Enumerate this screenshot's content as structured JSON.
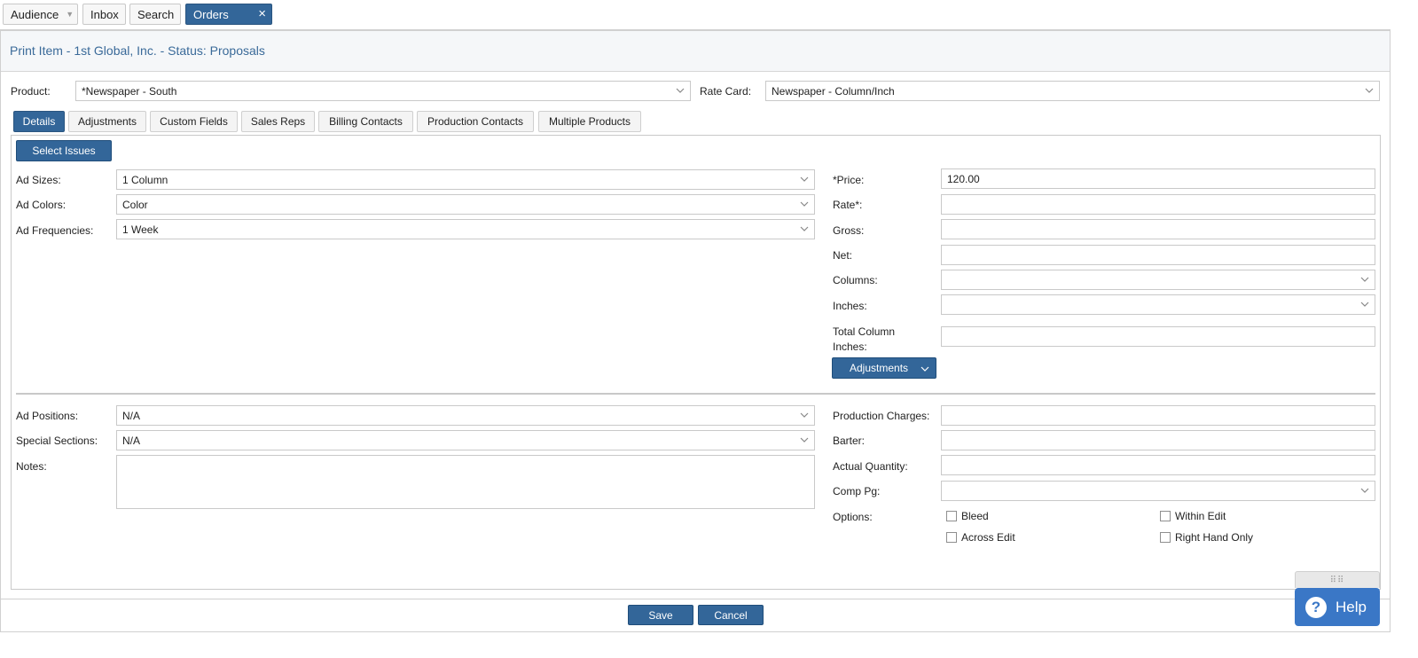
{
  "top_tabs": {
    "audience": "Audience",
    "inbox": "Inbox",
    "search": "Search",
    "orders": "Orders"
  },
  "header": {
    "title": "Print Item - 1st Global, Inc. - Status: Proposals"
  },
  "product": {
    "label": "Product:",
    "value": "*Newspaper - South"
  },
  "rate_card": {
    "label": "Rate Card:",
    "value": "Newspaper -  Column/Inch"
  },
  "tabs": {
    "details": "Details",
    "adjustments": "Adjustments",
    "custom_fields": "Custom Fields",
    "sales_reps": "Sales Reps",
    "billing_contacts": "Billing Contacts",
    "production_contacts": "Production Contacts",
    "multiple_products": "Multiple Products"
  },
  "select_issues": "Select Issues",
  "left": {
    "ad_sizes": {
      "label": "Ad Sizes:",
      "value": "1 Column"
    },
    "ad_colors": {
      "label": "Ad Colors:",
      "value": "Color"
    },
    "ad_frequencies": {
      "label": "Ad Frequencies:",
      "value": "1 Week"
    },
    "ad_positions": {
      "label": "Ad Positions:",
      "value": "N/A"
    },
    "special_sections": {
      "label": "Special Sections:",
      "value": "N/A"
    },
    "notes": {
      "label": "Notes:",
      "value": ""
    }
  },
  "right": {
    "price": {
      "label": "*Price:",
      "value": "120.00"
    },
    "rate": {
      "label": "Rate*:",
      "value": ""
    },
    "gross": {
      "label": "Gross:",
      "value": ""
    },
    "net": {
      "label": "Net:",
      "value": ""
    },
    "columns": {
      "label": "Columns:",
      "value": ""
    },
    "inches": {
      "label": "Inches:",
      "value": ""
    },
    "total_column_inches": {
      "label_line1": "Total Column",
      "label_line2": "Inches:",
      "value": ""
    },
    "adjustments_button": "Adjustments",
    "production_charges": {
      "label": "Production Charges:",
      "value": ""
    },
    "barter": {
      "label": "Barter:",
      "value": ""
    },
    "actual_quantity": {
      "label": "Actual Quantity:",
      "value": ""
    },
    "comp_pg": {
      "label": "Comp Pg:",
      "value": ""
    },
    "options": {
      "label": "Options:",
      "bleed": "Bleed",
      "within_edit": "Within Edit",
      "across_edit": "Across Edit",
      "right_hand_only": "Right Hand Only"
    }
  },
  "footer": {
    "save": "Save",
    "cancel": "Cancel"
  },
  "help": {
    "label": "Help",
    "icon_glyph": "?"
  }
}
